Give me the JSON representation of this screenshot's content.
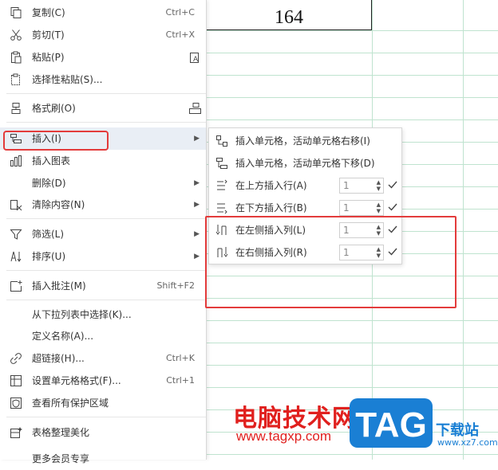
{
  "cell": {
    "value": "164"
  },
  "menu": {
    "items": [
      {
        "label": "复制(C)",
        "shortcut": "Ctrl+C",
        "icon": "copy-icon"
      },
      {
        "label": "剪切(T)",
        "shortcut": "Ctrl+X",
        "icon": "scissors-icon"
      },
      {
        "label": "粘贴(P)",
        "icon": "paste-icon"
      },
      {
        "label": "选择性粘贴(S)...",
        "icon": "paste-special-icon"
      },
      {
        "label": "格式刷(O)",
        "icon": "format-brush-icon"
      },
      {
        "label": "插入(I)",
        "icon": "insert-icon",
        "submenu": true
      },
      {
        "label": "插入图表",
        "icon": "chart-icon"
      },
      {
        "label": "删除(D)",
        "submenu": true
      },
      {
        "label": "清除内容(N)",
        "icon": "eraser-icon",
        "submenu": true
      },
      {
        "label": "筛选(L)",
        "icon": "filter-icon",
        "submenu": true
      },
      {
        "label": "排序(U)",
        "icon": "sort-icon",
        "submenu": true
      },
      {
        "label": "插入批注(M)",
        "shortcut": "Shift+F2",
        "icon": "comment-icon"
      },
      {
        "label": "从下拉列表中选择(K)..."
      },
      {
        "label": "定义名称(A)..."
      },
      {
        "label": "超链接(H)...",
        "shortcut": "Ctrl+K",
        "icon": "link-icon"
      },
      {
        "label": "设置单元格格式(F)...",
        "shortcut": "Ctrl+1",
        "icon": "cell-format-icon"
      },
      {
        "label": "查看所有保护区域",
        "icon": "shield-icon"
      },
      {
        "label": "表格整理美化",
        "icon": "beautify-icon"
      },
      {
        "label": "更多会员专享"
      }
    ]
  },
  "submenu": {
    "items": [
      {
        "label": "插入单元格，活动单元格右移(I)"
      },
      {
        "label": "插入单元格，活动单元格下移(D)"
      },
      {
        "label": "在上方插入行(A)",
        "value": "1"
      },
      {
        "label": "在下方插入行(B)",
        "value": "1"
      },
      {
        "label": "在左侧插入列(L)",
        "value": "1"
      },
      {
        "label": "在右侧插入列(R)",
        "value": "1"
      }
    ]
  },
  "watermark": {
    "site_cn": "电脑技术网",
    "site_url": "www.tagxp.com",
    "logo": "TAG",
    "xz_cn": "下载站",
    "xz_url": "www.xz7.com"
  },
  "colors": {
    "highlight": "#e33b3b",
    "watermark_red": "#e0201e",
    "logo_blue": "#1a7fd4",
    "grid": "#bfe3cf"
  }
}
